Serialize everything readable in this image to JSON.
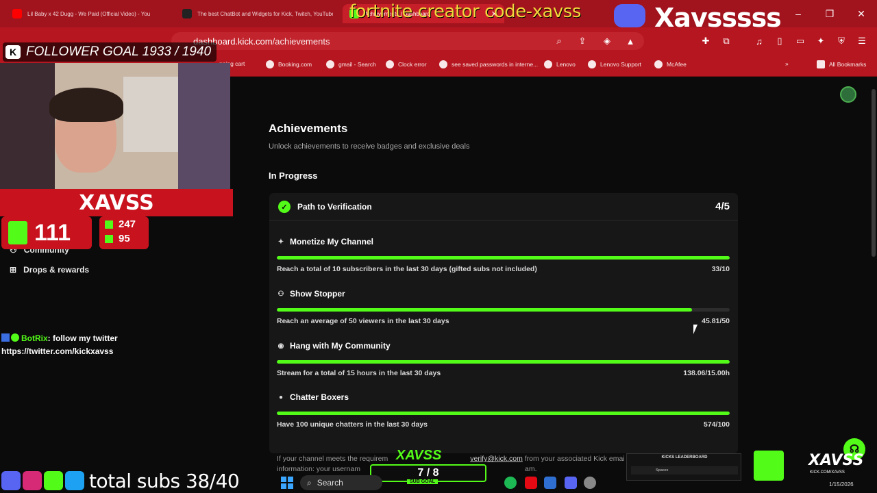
{
  "browser": {
    "tabs": [
      {
        "title": "Lil Baby x 42 Dugg - We Paid (Official Video) - You",
        "icon_color": "#ff0000"
      },
      {
        "title": "The best ChatBot and Widgets for Kick, Twitch, YouTube",
        "icon_color": "#222222"
      },
      {
        "title": "Achievements | Dashboard",
        "icon_color": "#53fc18"
      }
    ],
    "url_host": "dashboard.kick.com",
    "url_path": "/achievements",
    "bookmarks": [
      "pping cart",
      "Booking.com",
      "gmail - Search",
      "Clock error",
      "see saved passwords in interne...",
      "Lenovo",
      "Lenovo Support",
      "McAfee"
    ],
    "all_bookmarks": "All Bookmarks"
  },
  "sidebar": {
    "items": [
      {
        "label": "Community",
        "icon": "users-icon"
      },
      {
        "label": "Drops & rewards",
        "icon": "gift-icon"
      }
    ]
  },
  "main": {
    "title": "Achievements",
    "subtitle": "Unlock achievements to receive badges and exclusive deals",
    "section": "In Progress",
    "card": {
      "title": "Path to Verification",
      "count": "4/5",
      "items": [
        {
          "icon": "sparkle-icon",
          "title": "Monetize My Channel",
          "desc": "Reach a total of 10 subscribers in the last 30 days (gifted subs not included)",
          "value": "33/10",
          "progress": 1.0
        },
        {
          "icon": "users-icon",
          "title": "Show Stopper",
          "desc": "Reach an average of 50 viewers in the last 30 days",
          "value": "45.81/50",
          "progress": 0.9162
        },
        {
          "icon": "broadcast-icon",
          "title": "Hang with My Community",
          "desc": "Stream for a total of 15 hours in the last 30 days",
          "value": "138.06/15.00h",
          "progress": 1.0
        },
        {
          "icon": "chat-icon",
          "title": "Chatter Boxers",
          "desc": "Have 100 unique chatters in the last 30 days",
          "value": "574/100",
          "progress": 1.0
        }
      ]
    },
    "footnote_pre": "If your channel meets the requirem",
    "footnote_link": "verify@kick.com",
    "footnote_post": " from your associated Kick emai",
    "footnote_line2": "information: your usernam",
    "footnote_line2_end": "am."
  },
  "overlay": {
    "top_text": "fortnite creator code-xavss",
    "name_text": "Xavsssss",
    "follower_goal": "FOLLOWER GOAL 1933 / 1940",
    "nameplate": "XAVSS",
    "stat_big": "111",
    "stat_a": "247",
    "stat_b": "95",
    "chat_user": "BotRix",
    "chat_msg": ": follow my twitter",
    "chat_link": "https://twitter.com/kickxavss",
    "subgoal_title": "XAVSS",
    "subgoal_value": "7 / 8",
    "subgoal_label": "SUB GOAL",
    "leaderboard_title": "KICKS LEADERBOARD",
    "leaderboard_row": "Spacex",
    "logo_text": "XAVSS",
    "logo_sub": "KICK.COM/XAVSS",
    "total_subs": "total subs 38/40"
  },
  "taskbar": {
    "search": "Search",
    "date": "1/15/2026"
  }
}
